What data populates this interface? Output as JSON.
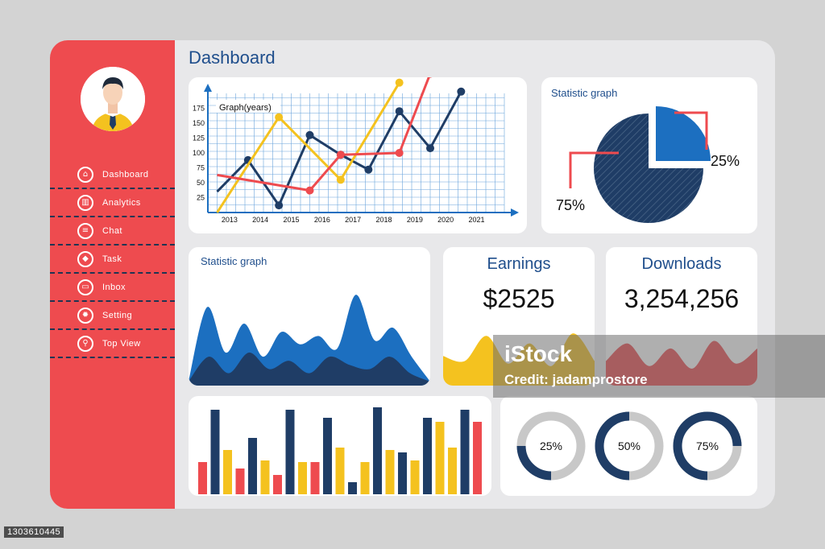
{
  "header": {
    "title": "Dashboard"
  },
  "sidebar": {
    "items": [
      {
        "label": "Dashboard",
        "icon": "home-icon",
        "glyph": "⌂"
      },
      {
        "label": "Analytics",
        "icon": "analytics-icon",
        "glyph": "▥"
      },
      {
        "label": "Chat",
        "icon": "chat-icon",
        "glyph": "≡"
      },
      {
        "label": "Task",
        "icon": "task-icon",
        "glyph": "◆"
      },
      {
        "label": "Inbox",
        "icon": "inbox-icon",
        "glyph": "▭"
      },
      {
        "label": "Setting",
        "icon": "gear-icon",
        "glyph": "✹"
      },
      {
        "label": "Top View",
        "icon": "search-icon",
        "glyph": "⚲"
      }
    ]
  },
  "colors": {
    "accent_red": "#ee4b4f",
    "navy": "#1f3d66",
    "blue": "#1c6fc0",
    "yellow": "#f4c21f",
    "grid": "#6aa3dc",
    "light_gray": "#c8c8c8"
  },
  "line_card": {
    "label": "Graph(years)"
  },
  "pie_card": {
    "label": "Statistic graph",
    "large_label": "75%",
    "small_label": "25%"
  },
  "area_card": {
    "label": "Statistic graph"
  },
  "earnings": {
    "title": "Earnings",
    "value": "$2525"
  },
  "downloads": {
    "title": "Downloads",
    "value": "3,254,256"
  },
  "donuts": [
    {
      "label": "25%",
      "value": 0.25
    },
    {
      "label": "50%",
      "value": 0.5
    },
    {
      "label": "75%",
      "value": 0.75
    }
  ],
  "watermark": {
    "logo": "iStock",
    "credit": "Credit: jadamprostore"
  },
  "stock_id": "1303610445",
  "chart_data": [
    {
      "type": "line",
      "title": "Graph(years)",
      "categories": [
        "2013",
        "2014",
        "2015",
        "2016",
        "2017",
        "2018",
        "2019",
        "2020",
        "2021"
      ],
      "y_ticks": [
        25,
        50,
        75,
        100,
        125,
        150,
        175
      ],
      "ylim": [
        0,
        200
      ],
      "series": [
        {
          "color": "#1f3d66",
          "points": [
            [
              2012.6,
              35
            ],
            [
              2013.6,
              88
            ],
            [
              2014.6,
              12
            ],
            [
              2015.6,
              130
            ],
            [
              2016.6,
              97
            ],
            [
              2017.5,
              72
            ],
            [
              2018.5,
              170
            ],
            [
              2019.5,
              108
            ],
            [
              2020.5,
              203
            ]
          ]
        },
        {
          "color": "#f4c21f",
          "points": [
            [
              2012.6,
              0
            ],
            [
              2014.6,
              160
            ],
            [
              2016.6,
              55
            ],
            [
              2018.5,
              218
            ]
          ]
        },
        {
          "color": "#ee4b4f",
          "points": [
            [
              2012.6,
              63
            ],
            [
              2015.6,
              37
            ],
            [
              2016.6,
              97
            ],
            [
              2018.5,
              100
            ],
            [
              2019.5,
              233
            ]
          ]
        }
      ]
    },
    {
      "type": "pie",
      "title": "Statistic graph",
      "slices": [
        {
          "label": "75%",
          "value": 75,
          "color": "#1f3d66"
        },
        {
          "label": "25%",
          "value": 25,
          "color": "#1c6fc0"
        }
      ]
    },
    {
      "type": "area",
      "title": "Statistic graph",
      "series": [
        {
          "color": "#1c6fc0",
          "values": [
            5,
            95,
            40,
            75,
            35,
            65,
            50,
            60,
            45,
            110,
            55,
            70,
            35,
            5
          ]
        },
        {
          "color": "#1f3d66",
          "values": [
            5,
            35,
            15,
            40,
            20,
            30,
            15,
            35,
            25,
            20,
            35,
            15,
            5
          ]
        }
      ]
    },
    {
      "type": "area",
      "title": "Earnings",
      "color": "#f4c21f",
      "values": [
        30,
        20,
        70,
        15,
        55,
        10,
        75,
        20
      ]
    },
    {
      "type": "area",
      "title": "Downloads",
      "color": "#ee4b4f",
      "values": [
        20,
        55,
        10,
        45,
        5,
        60,
        15,
        45
      ]
    },
    {
      "type": "bar",
      "series": [
        {
          "color": "#ee4b4f",
          "values": [
            40,
            32,
            24,
            40,
            90
          ]
        },
        {
          "color": "#1f3d66",
          "values": [
            105,
            70,
            105,
            95,
            15,
            108,
            52,
            95
          ]
        },
        {
          "color": "#f4c21f",
          "values": [
            55,
            42,
            40,
            58,
            40,
            55,
            42,
            90,
            58
          ]
        }
      ],
      "order": [
        "r",
        "n",
        "y",
        "r",
        "n",
        "y",
        "r",
        "n",
        "y",
        "r",
        "n",
        "y",
        "n",
        "y",
        "n",
        "y",
        "n",
        "y",
        "n",
        "y",
        "y",
        "n",
        "r"
      ]
    }
  ]
}
